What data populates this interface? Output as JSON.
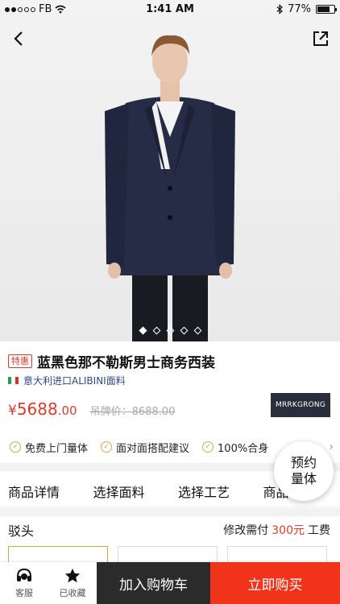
{
  "status": {
    "carrier": "FB",
    "time": "1:41 AM",
    "battery": "77%",
    "battery_level": 0.77
  },
  "hero": {
    "carousel_count": 5,
    "carousel_active": 0
  },
  "product": {
    "badge": "特惠",
    "title": "蓝黑色那不勒斯男士商务西装",
    "origin": "意大利进口ALIBINI面料",
    "currency": "¥",
    "price_int": "5688",
    "price_dec": ".00",
    "original_price": "吊牌价：8688.00",
    "brand": "MRRKGRONG"
  },
  "services": [
    {
      "icon": "check-circle-icon",
      "label": "免费上门量体"
    },
    {
      "icon": "check-circle-icon",
      "label": "面对面搭配建议"
    },
    {
      "icon": "check-circle-icon",
      "label": "100%合身"
    }
  ],
  "appointment": {
    "line1": "预约",
    "line2": "量体"
  },
  "tabs": [
    "商品详情",
    "选择面料",
    "选择工艺",
    "商品评价"
  ],
  "section": {
    "title": "驳头",
    "fee_prefix": "修改需付",
    "fee_amount": "300元",
    "fee_suffix": "工费"
  },
  "bottom": {
    "service_label": "客服",
    "favorite_label": "已收藏",
    "cart_label": "加入购物车",
    "buy_label": "立即购买"
  },
  "colors": {
    "accent_red": "#f2331c",
    "gold": "#d6a64a",
    "dark": "#2b2b2b"
  }
}
